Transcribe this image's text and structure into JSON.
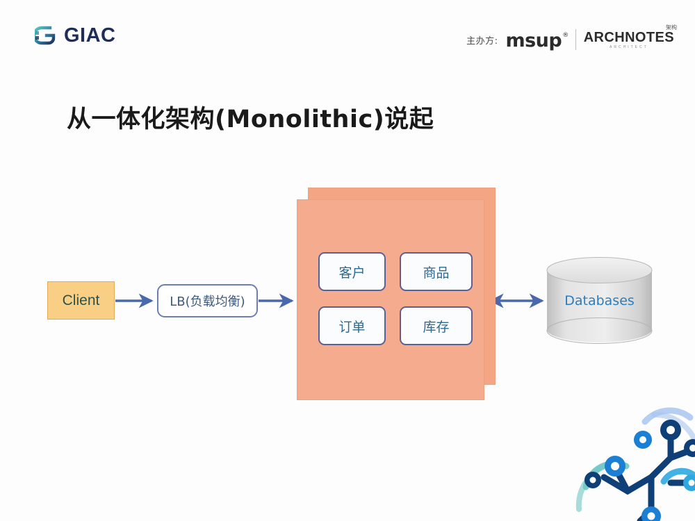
{
  "page": {
    "background_color": "#fdfdfd"
  },
  "header": {
    "brand": {
      "name": "GIAC",
      "mark_icon": "giac-g-mark-icon",
      "colors": [
        "#1f2d57",
        "#3aa3a8"
      ]
    },
    "sponsor": {
      "label": "主办方:",
      "msup": "msup",
      "msup_trademark": "®",
      "archnotes": "ARCHNOTES",
      "archnotes_cn": "架构",
      "archnotes_sub": "ARCHITECT"
    }
  },
  "title": "从一体化架构(Monolithic)说起",
  "diagram": {
    "client": {
      "label": "Client",
      "fill": "#f8cf84",
      "border": "#e2ab5a",
      "text_color": "#2f5249"
    },
    "load_balancer": {
      "label": "LB(负载均衡)",
      "fill": "#ffffff",
      "border": "#6c7fb5",
      "text_color": "#3c5b80"
    },
    "monolith": {
      "fill_front": "#f5ab8d",
      "fill_back": "#f3a584",
      "services": [
        {
          "label": "客户"
        },
        {
          "label": "商品"
        },
        {
          "label": "订单"
        },
        {
          "label": "库存"
        }
      ],
      "service_border": "#5a5f96",
      "service_text_color": "#2c6a92"
    },
    "database": {
      "label": "Databases",
      "shape": "cylinder",
      "fill": "#d4d4d4",
      "text_color": "#2b7dbf"
    },
    "arrows": [
      {
        "name": "client-to-lb",
        "direction": "right",
        "color": "#4a69ad"
      },
      {
        "name": "lb-to-monolith",
        "direction": "right",
        "color": "#4a69ad"
      },
      {
        "name": "monolith-to-database",
        "direction": "both",
        "color": "#4a69ad"
      }
    ]
  },
  "decoration": {
    "name": "network-nodes-graphic",
    "colors": [
      "#0f3f77",
      "#1b7fd4",
      "#6fc7c4",
      "#a8c6ef"
    ]
  }
}
